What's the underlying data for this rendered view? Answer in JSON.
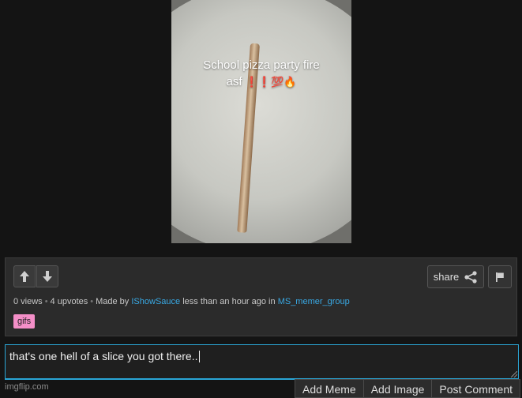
{
  "meme": {
    "caption_line1": "School pizza party fire",
    "caption_line2": "asf",
    "caption_emoji": "❗❗💯🔥"
  },
  "actions": {
    "share_label": "share"
  },
  "meta": {
    "views": "0 views",
    "upvotes": "4 upvotes",
    "made_by_prefix": "Made by",
    "author": "IShowSauce",
    "time_text": "less than an hour ago in",
    "stream": "MS_memer_group"
  },
  "tags": [
    "gifs"
  ],
  "comment": {
    "value": "that's one hell of a slice you got there.."
  },
  "footer": {
    "watermark": "imgflip.com",
    "add_meme": "Add Meme",
    "add_image": "Add Image",
    "post_comment": "Post Comment"
  },
  "colors": {
    "link": "#39a8e3",
    "tag_bg": "#f48fc8",
    "focus_border": "#2aa6d6"
  }
}
